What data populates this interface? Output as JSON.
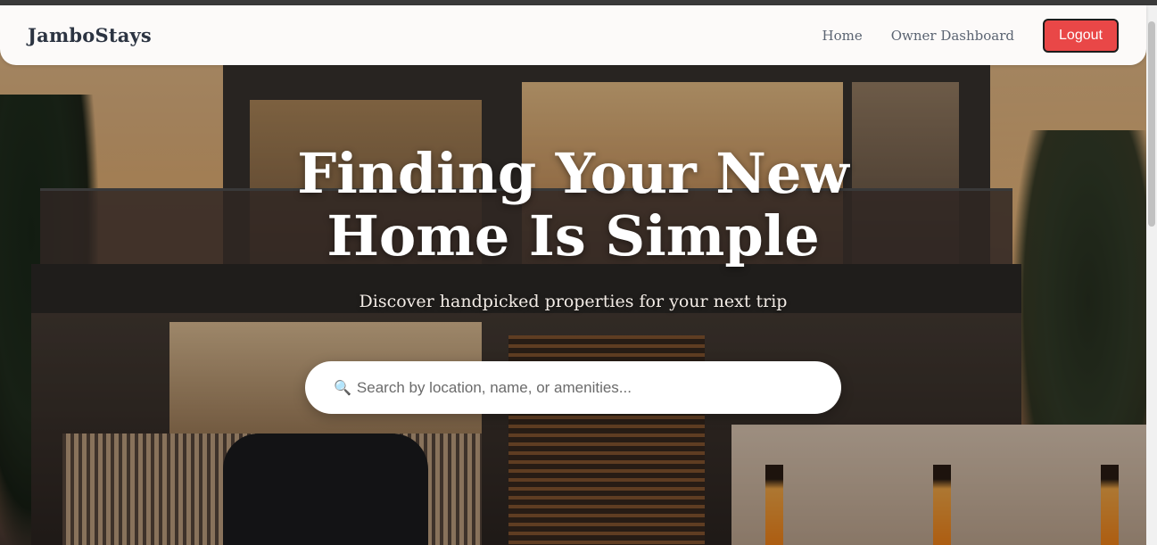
{
  "navbar": {
    "brand": "JamboStays",
    "links": [
      {
        "label": "Home"
      },
      {
        "label": "Owner Dashboard"
      }
    ],
    "logout_label": "Logout",
    "logout_color": "#e94747"
  },
  "hero": {
    "title_line1": "Finding Your New",
    "title_line2": "Home Is Simple",
    "subtitle": "Discover handpicked properties for your next trip",
    "search": {
      "icon": "search-icon",
      "placeholder": "Search by location, name, or amenities..."
    }
  }
}
